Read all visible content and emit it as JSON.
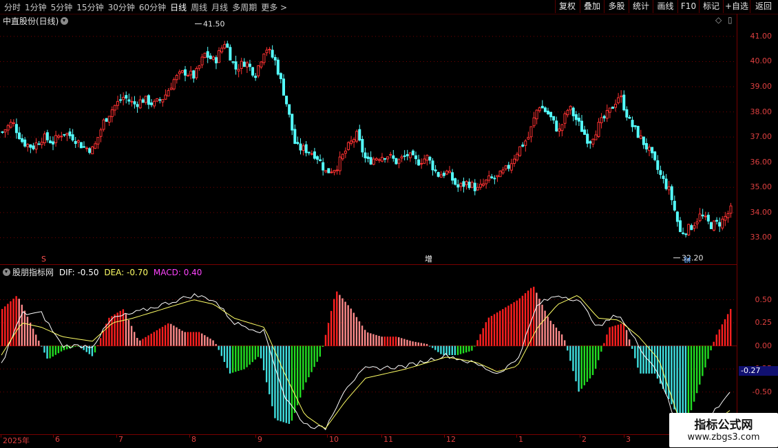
{
  "toolbar": {
    "periods": [
      "分时",
      "1分钟",
      "5分钟",
      "15分钟",
      "30分钟",
      "60分钟",
      "日线",
      "周线",
      "月线",
      "多周期",
      "更多 >"
    ],
    "active_period": "日线",
    "buttons": [
      "复权",
      "叠加",
      "多股",
      "统计",
      "画线",
      "F10",
      "+自选",
      "返回"
    ],
    "mark_label": "标记"
  },
  "main_panel": {
    "title": "中直股份(日线)",
    "high_label": "41.50",
    "low_label": "32.20",
    "marks": {
      "s": "S",
      "zeng": "增",
      "cai": "财"
    },
    "axis_ticks": [
      "41.00",
      "40.00",
      "39.00",
      "38.00",
      "37.00",
      "36.00",
      "35.00",
      "34.00",
      "33.00"
    ]
  },
  "macd_panel": {
    "title": "股朋指标网",
    "dif_label": "DIF: -0.50",
    "dea_label": "DEA: -0.70",
    "macd_label": "MACD: 0.40",
    "axis_ticks": [
      "0.50",
      "0.25",
      "0.00",
      "-0.25",
      "-0.50"
    ],
    "current_value": "-0.27"
  },
  "x_axis": {
    "labels": [
      "2025年",
      "6",
      "7",
      "8",
      "9",
      "10",
      "11",
      "12",
      "1",
      "2",
      "3"
    ]
  },
  "watermark": {
    "line1": "指标公式网",
    "line2": "www.zbgs3.com"
  },
  "colors": {
    "up": "#ff3232",
    "down": "#54ffff",
    "macd_pos_grow": "#ff2020",
    "macd_pos_fall": "#ff8a8a",
    "macd_neg_fall": "#40e0e0",
    "macd_neg_grow": "#22dd22",
    "dif": "#ffffff",
    "dea": "#ffff66"
  },
  "chart_data": [
    {
      "type": "candlestick",
      "title": "中直股份(日线)",
      "y_ticks": [
        33,
        34,
        35,
        36,
        37,
        38,
        39,
        40,
        41
      ],
      "ylim": [
        32.0,
        41.9
      ],
      "close_path": [
        [
          0,
          37.2
        ],
        [
          10,
          37.6
        ],
        [
          20,
          36.8
        ],
        [
          30,
          36.6
        ],
        [
          40,
          37.0
        ],
        [
          50,
          36.8
        ],
        [
          60,
          37.2
        ],
        [
          70,
          37.0
        ],
        [
          80,
          36.6
        ],
        [
          90,
          36.5
        ],
        [
          100,
          37.6
        ],
        [
          110,
          38.2
        ],
        [
          120,
          38.6
        ],
        [
          130,
          38.3
        ],
        [
          140,
          38.5
        ],
        [
          150,
          38.3
        ],
        [
          160,
          38.6
        ],
        [
          170,
          39.3
        ],
        [
          180,
          39.6
        ],
        [
          190,
          39.4
        ],
        [
          200,
          40.3
        ],
        [
          210,
          40.0
        ],
        [
          220,
          40.8
        ],
        [
          230,
          39.7
        ],
        [
          240,
          40.0
        ],
        [
          250,
          39.5
        ],
        [
          260,
          40.6
        ],
        [
          270,
          40.0
        ],
        [
          280,
          38.5
        ],
        [
          290,
          36.6
        ],
        [
          300,
          36.5
        ],
        [
          310,
          36.3
        ],
        [
          320,
          35.6
        ],
        [
          330,
          35.8
        ],
        [
          340,
          36.5
        ],
        [
          350,
          37.1
        ],
        [
          360,
          36.0
        ],
        [
          370,
          36.2
        ],
        [
          380,
          36.3
        ],
        [
          390,
          36.0
        ],
        [
          400,
          36.3
        ],
        [
          410,
          36.0
        ],
        [
          420,
          36.2
        ],
        [
          430,
          35.5
        ],
        [
          440,
          35.6
        ],
        [
          450,
          35.0
        ],
        [
          460,
          35.2
        ],
        [
          470,
          34.9
        ],
        [
          480,
          35.3
        ],
        [
          490,
          35.4
        ],
        [
          500,
          35.8
        ],
        [
          510,
          36.5
        ],
        [
          520,
          37.0
        ],
        [
          530,
          38.3
        ],
        [
          540,
          37.9
        ],
        [
          550,
          37.2
        ],
        [
          560,
          38.2
        ],
        [
          570,
          37.5
        ],
        [
          580,
          36.8
        ],
        [
          590,
          37.5
        ],
        [
          600,
          38.0
        ],
        [
          610,
          38.7
        ],
        [
          620,
          37.6
        ],
        [
          630,
          37.0
        ],
        [
          640,
          36.4
        ],
        [
          650,
          35.5
        ],
        [
          660,
          34.8
        ],
        [
          670,
          33.2
        ],
        [
          680,
          33.4
        ],
        [
          690,
          33.9
        ],
        [
          700,
          33.5
        ],
        [
          710,
          33.6
        ],
        [
          720,
          34.1
        ]
      ],
      "bars": 720,
      "annotations": [
        {
          "label": "41.50",
          "value": 41.5
        },
        {
          "label": "32.20",
          "value": 32.2
        }
      ]
    },
    {
      "type": "bar",
      "title": "股朋指标网",
      "series": [
        {
          "name": "DIF",
          "points": [
            [
              0,
              -0.2
            ],
            [
              20,
              0.35
            ],
            [
              40,
              0.35
            ],
            [
              60,
              0.0
            ],
            [
              90,
              0.0
            ],
            [
              110,
              0.3
            ],
            [
              130,
              0.35
            ],
            [
              160,
              0.45
            ],
            [
              190,
              0.55
            ],
            [
              210,
              0.5
            ],
            [
              230,
              0.25
            ],
            [
              260,
              0.15
            ],
            [
              280,
              -0.55
            ],
            [
              300,
              -0.85
            ],
            [
              320,
              -0.9
            ],
            [
              340,
              -0.45
            ],
            [
              360,
              -0.25
            ],
            [
              400,
              -0.22
            ],
            [
              440,
              -0.1
            ],
            [
              470,
              -0.2
            ],
            [
              490,
              -0.3
            ],
            [
              510,
              -0.15
            ],
            [
              530,
              0.45
            ],
            [
              550,
              0.55
            ],
            [
              570,
              0.5
            ],
            [
              590,
              0.2
            ],
            [
              610,
              0.35
            ],
            [
              630,
              0.0
            ],
            [
              650,
              -0.3
            ],
            [
              670,
              -0.95
            ],
            [
              690,
              -0.9
            ],
            [
              720,
              -0.5
            ]
          ]
        },
        {
          "name": "DEA",
          "points": [
            [
              0,
              -0.1
            ],
            [
              20,
              0.25
            ],
            [
              40,
              0.2
            ],
            [
              60,
              0.1
            ],
            [
              90,
              0.05
            ],
            [
              110,
              0.25
            ],
            [
              130,
              0.3
            ],
            [
              160,
              0.4
            ],
            [
              190,
              0.5
            ],
            [
              210,
              0.45
            ],
            [
              230,
              0.3
            ],
            [
              260,
              0.2
            ],
            [
              280,
              -0.3
            ],
            [
              300,
              -0.75
            ],
            [
              320,
              -0.9
            ],
            [
              340,
              -0.6
            ],
            [
              360,
              -0.35
            ],
            [
              400,
              -0.25
            ],
            [
              440,
              -0.12
            ],
            [
              470,
              -0.18
            ],
            [
              490,
              -0.28
            ],
            [
              510,
              -0.22
            ],
            [
              530,
              0.2
            ],
            [
              550,
              0.45
            ],
            [
              570,
              0.55
            ],
            [
              590,
              0.3
            ],
            [
              610,
              0.28
            ],
            [
              630,
              0.1
            ],
            [
              650,
              -0.15
            ],
            [
              670,
              -0.8
            ],
            [
              690,
              -0.95
            ],
            [
              720,
              -0.7
            ]
          ]
        },
        {
          "name": "MACD",
          "points": [
            [
              0,
              0.4
            ],
            [
              15,
              0.55
            ],
            [
              30,
              0.2
            ],
            [
              45,
              -0.15
            ],
            [
              60,
              -0.05
            ],
            [
              75,
              0.0
            ],
            [
              90,
              -0.12
            ],
            [
              105,
              0.3
            ],
            [
              120,
              0.4
            ],
            [
              135,
              0.05
            ],
            [
              150,
              0.15
            ],
            [
              165,
              0.25
            ],
            [
              180,
              0.15
            ],
            [
              195,
              0.15
            ],
            [
              210,
              0.05
            ],
            [
              225,
              -0.3
            ],
            [
              240,
              -0.25
            ],
            [
              255,
              -0.1
            ],
            [
              270,
              -0.8
            ],
            [
              285,
              -0.85
            ],
            [
              300,
              -0.4
            ],
            [
              315,
              -0.1
            ],
            [
              330,
              0.6
            ],
            [
              345,
              0.4
            ],
            [
              360,
              0.15
            ],
            [
              375,
              0.1
            ],
            [
              390,
              0.1
            ],
            [
              405,
              0.05
            ],
            [
              420,
              0.02
            ],
            [
              435,
              -0.1
            ],
            [
              450,
              -0.1
            ],
            [
              465,
              -0.05
            ],
            [
              480,
              0.3
            ],
            [
              495,
              0.4
            ],
            [
              510,
              0.5
            ],
            [
              525,
              0.65
            ],
            [
              540,
              0.3
            ],
            [
              555,
              0.1
            ],
            [
              570,
              -0.5
            ],
            [
              585,
              -0.3
            ],
            [
              600,
              0.2
            ],
            [
              615,
              0.25
            ],
            [
              630,
              -0.3
            ],
            [
              645,
              -0.3
            ],
            [
              660,
              -0.6
            ],
            [
              675,
              -0.9
            ],
            [
              690,
              -0.4
            ],
            [
              705,
              0.1
            ],
            [
              720,
              0.4
            ]
          ]
        }
      ],
      "y_ticks": [
        -0.5,
        -0.25,
        0,
        0.25,
        0.5
      ],
      "ylim": [
        -0.95,
        0.75
      ]
    }
  ]
}
